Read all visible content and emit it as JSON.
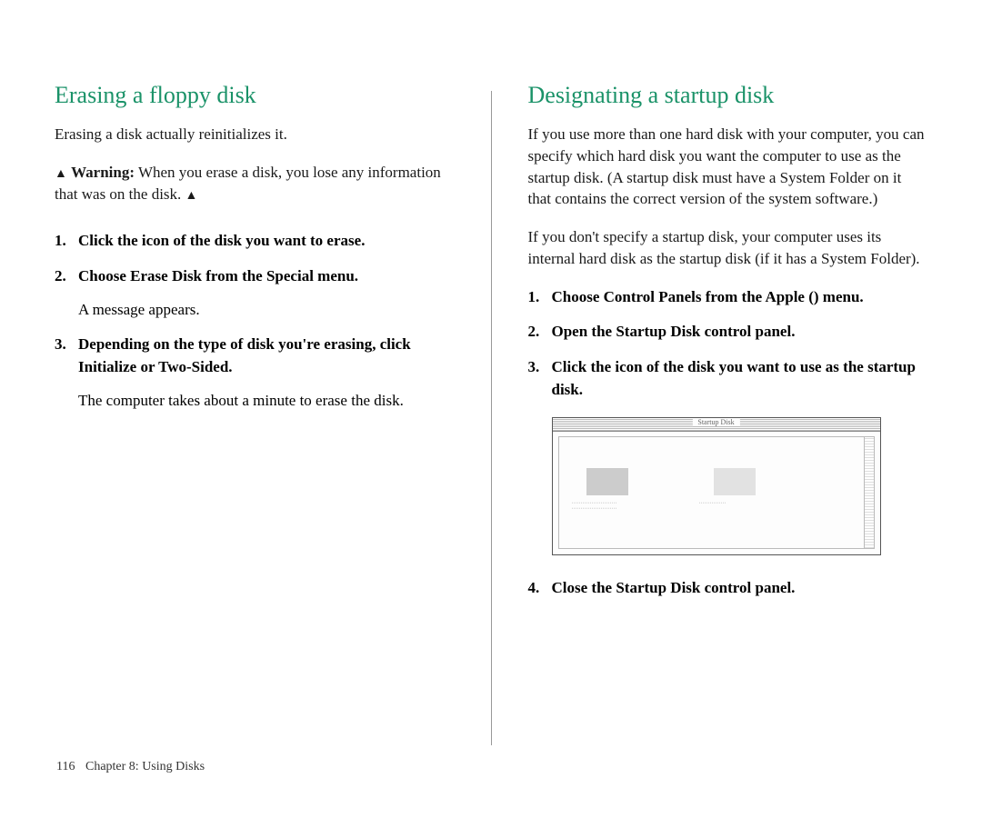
{
  "left": {
    "heading": "Erasing a floppy disk",
    "intro": "Erasing a disk actually reinitializes it.",
    "warning_label": "Warning:",
    "warning_text": "When you erase a disk, you lose any information that was on the disk.",
    "steps": [
      {
        "title": "Click the icon of the disk you want to erase."
      },
      {
        "title": "Choose Erase Disk from the Special menu.",
        "note": "A message appears."
      },
      {
        "title": "Depending on the type of disk you're erasing, click Initialize or Two-Sided.",
        "note": "The computer takes about a minute to erase the disk."
      }
    ]
  },
  "right": {
    "heading": "Designating a startup disk",
    "intro1": "If you use more than one hard disk with your computer, you can specify which hard disk you want the computer to use as the startup disk. (A startup disk must have a System Folder on it that contains the correct version of the system software.)",
    "intro2": "If you don't specify a startup disk, your computer uses its internal hard disk as the startup disk (if it has a System Folder).",
    "steps_a": [
      {
        "title_pre": "Choose Control Panels from the Apple (",
        "title_post": ") menu."
      },
      {
        "title": "Open the Startup Disk control panel."
      },
      {
        "title": "Click the icon of the disk you want to use as the startup disk."
      }
    ],
    "steps_b": [
      {
        "title": "Close the Startup Disk control panel."
      }
    ],
    "figure_title": "Startup Disk"
  },
  "footer": {
    "page_number": "116",
    "chapter": "Chapter 8: Using Disks"
  },
  "icons": {
    "triangle_up": "▲",
    "apple": ""
  }
}
